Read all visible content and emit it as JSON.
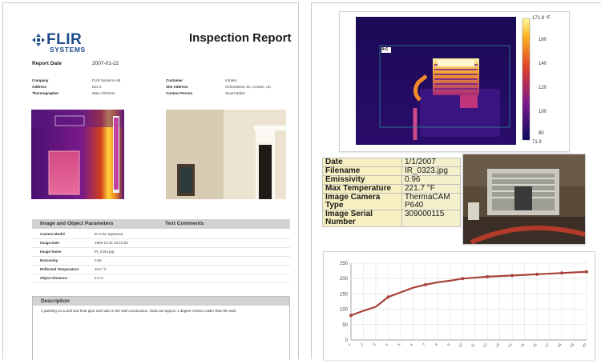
{
  "left_report": {
    "brand": {
      "name": "FLIR",
      "sub": "SYSTEMS"
    },
    "title": "Inspection Report",
    "report_date": {
      "label": "Report Date",
      "value": "2007-01-22"
    },
    "info": {
      "company": {
        "label": "Company",
        "value": "FLIR Systems AB"
      },
      "address": {
        "label": "Address",
        "value": "Box 3"
      },
      "thermographer": {
        "label": "Thermographer",
        "value": "Mats Ahlström"
      },
      "customer": {
        "label": "Customer",
        "value": "Infratec"
      },
      "site_address": {
        "label": "Site Address",
        "value": "Oxfordstreet 16, London, UK"
      },
      "contact_person": {
        "label": "Contact Person",
        "value": "Stuart Baker"
      }
    },
    "params_header": "Image and Object Parameters",
    "comments_header": "Text Comments",
    "params": [
      {
        "label": "Camera Model",
        "value": "B-CAM Japanese,"
      },
      {
        "label": "Image Date",
        "value": "1999-12-31 20:10:55"
      },
      {
        "label": "Image Name",
        "value": "IR_0164.jpg"
      },
      {
        "label": "Emissivity",
        "value": "0.96"
      },
      {
        "label": "Reflected Temperature",
        "value": "20.0 °C"
      },
      {
        "label": "Object Distance",
        "value": "2.0 m"
      }
    ],
    "description_header": "Description",
    "description_text": "A painting on a wall and heat pipe and nails in the wall construction. Nails are approx 1 degree celsius colder than the wall."
  },
  "thermal_image": {
    "scale_max": "171.8 °F",
    "scale_min": "71.9",
    "scale_ticks": [
      "160",
      "140",
      "120",
      "100",
      "80"
    ],
    "box_label": "Ar1"
  },
  "image_info_table": [
    {
      "label": "Date",
      "value": "1/1/2007"
    },
    {
      "label": "Filename",
      "value": "IR_0323.jpg"
    },
    {
      "label": "Emissivity",
      "value": "0.96"
    },
    {
      "label": "Max Temperature",
      "value": "221.7 °F"
    },
    {
      "label": "Image Camera Type",
      "value": "ThermaCAM P640"
    },
    {
      "label": "Image Serial Number",
      "value": "309000115"
    }
  ],
  "chart_data": {
    "type": "line",
    "title": "",
    "xlabel": "",
    "ylabel": "",
    "ylim": [
      0,
      250
    ],
    "yticks": [
      0,
      50,
      100,
      150,
      200,
      250
    ],
    "grid": true,
    "x": [
      "1",
      "2",
      "3",
      "4",
      "5",
      "6",
      "7",
      "8",
      "9",
      "10",
      "11",
      "12",
      "13",
      "14",
      "15",
      "16",
      "17",
      "18",
      "19",
      "20"
    ],
    "series": [
      {
        "name": "",
        "color": "#a8413a",
        "markers": [
          0,
          3,
          6,
          9,
          11,
          13,
          15,
          17,
          19
        ],
        "values": [
          80,
          95,
          108,
          140,
          155,
          170,
          180,
          188,
          193,
          200,
          203,
          206,
          208,
          210,
          212,
          214,
          216,
          218,
          220,
          222
        ]
      }
    ]
  },
  "colors": {
    "brand": "#1c4b8c",
    "section_header": "#d2d2d2",
    "table_yellow": "#f6efc0",
    "series_line": "#a8413a"
  }
}
